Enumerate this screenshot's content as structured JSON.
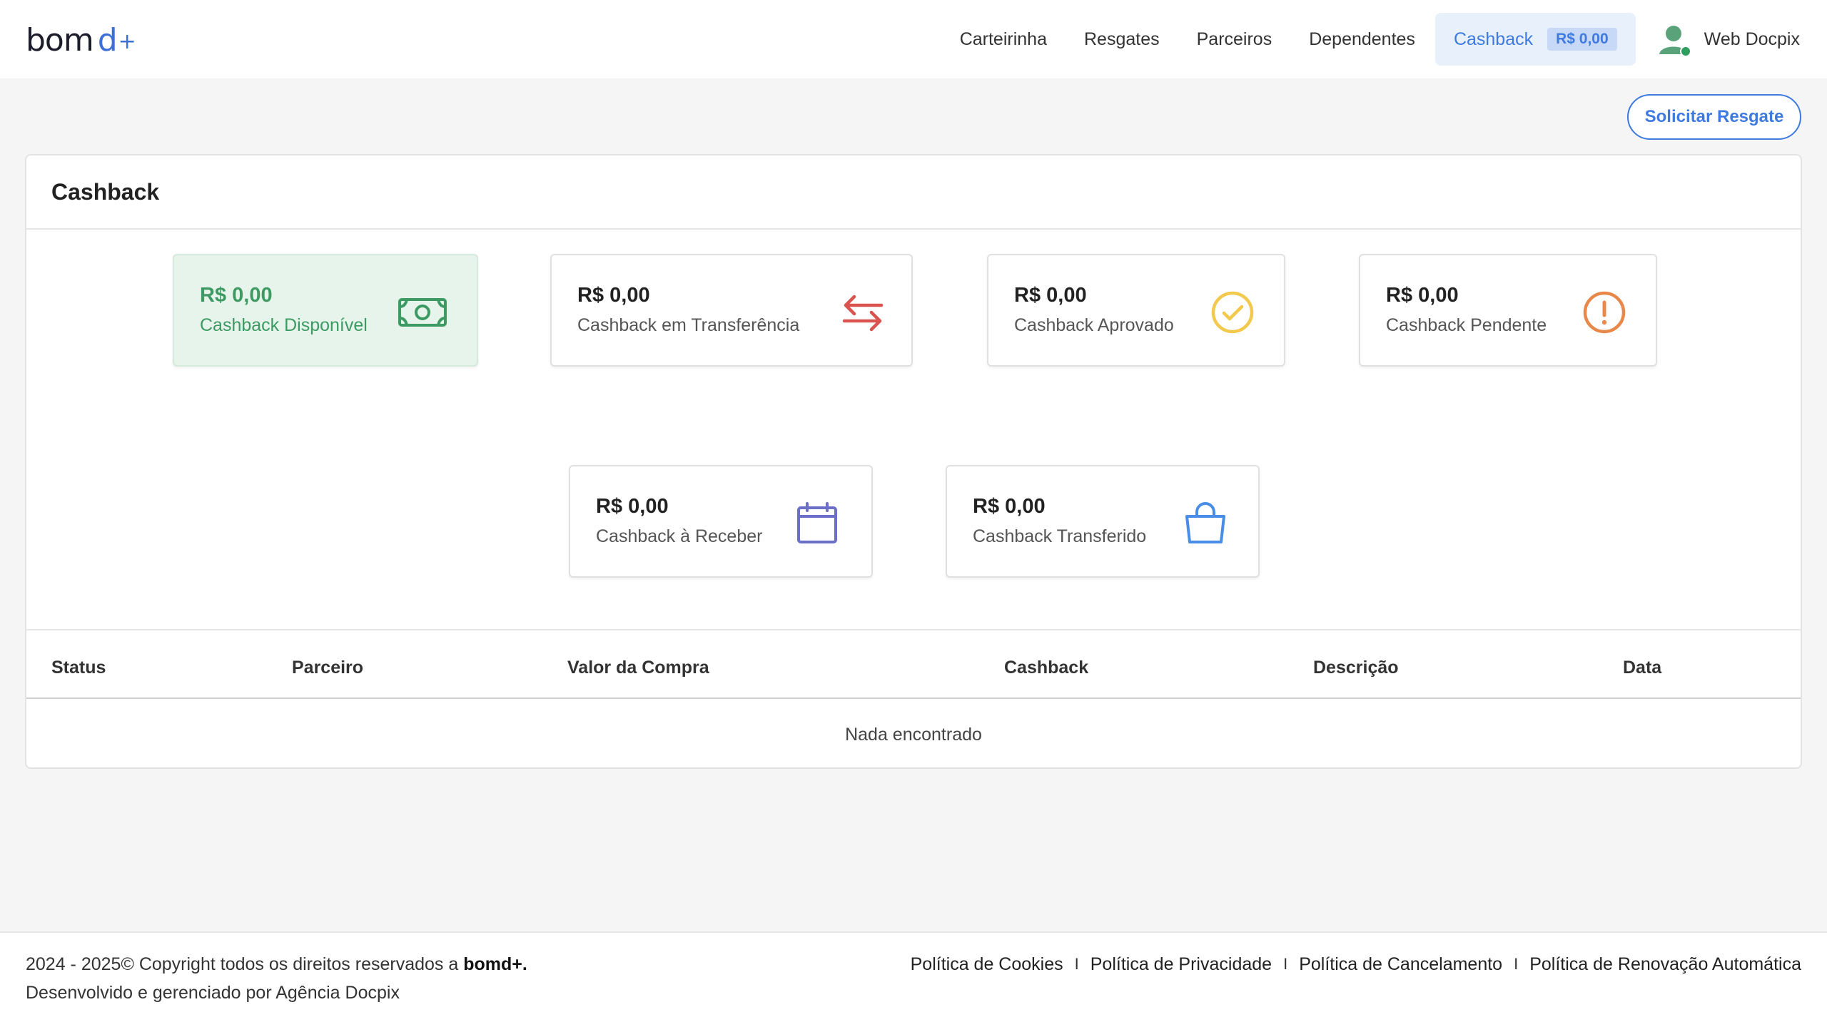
{
  "brand": {
    "logo_main": "bom",
    "logo_accent": "d",
    "logo_plus": "+"
  },
  "nav": {
    "items": [
      {
        "label": "Carteirinha"
      },
      {
        "label": "Resgates"
      },
      {
        "label": "Parceiros"
      },
      {
        "label": "Dependentes"
      }
    ],
    "active": {
      "label": "Cashback",
      "badge": "R$ 0,00"
    },
    "user_name": "Web Docpix"
  },
  "actions": {
    "solicitar_label": "Solicitar Resgate"
  },
  "card": {
    "title": "Cashback",
    "stats": [
      {
        "amount": "R$ 0,00",
        "label": "Cashback Disponível",
        "icon": "money-icon",
        "color": "#3c9a62"
      },
      {
        "amount": "R$ 0,00",
        "label": "Cashback em Transferência",
        "icon": "transfer-arrows-icon",
        "color": "#d9534f"
      },
      {
        "amount": "R$ 0,00",
        "label": "Cashback Aprovado",
        "icon": "check-circle-icon",
        "color": "#f2c94c"
      },
      {
        "amount": "R$ 0,00",
        "label": "Cashback Pendente",
        "icon": "exclamation-circle-icon",
        "color": "#e8884a"
      },
      {
        "amount": "R$ 0,00",
        "label": "Cashback à Receber",
        "icon": "calendar-icon",
        "color": "#6b6fc7"
      },
      {
        "amount": "R$ 0,00",
        "label": "Cashback Transferido",
        "icon": "shopping-bag-icon",
        "color": "#4a8de8"
      }
    ]
  },
  "table": {
    "columns": [
      "Status",
      "Parceiro",
      "Valor da Compra",
      "Cashback",
      "Descrição",
      "Data"
    ],
    "empty_text": "Nada encontrado"
  },
  "footer": {
    "copyright_prefix": "2024 - 2025© Copyright todos os direitos reservados a ",
    "copyright_brand": "bomd+.",
    "developed": "Desenvolvido e gerenciado por Agência Docpix",
    "links": [
      "Política de Cookies",
      "Política de Privacidade",
      "Política de Cancelamento",
      "Política de Renovação Automática"
    ],
    "separator": "I"
  }
}
